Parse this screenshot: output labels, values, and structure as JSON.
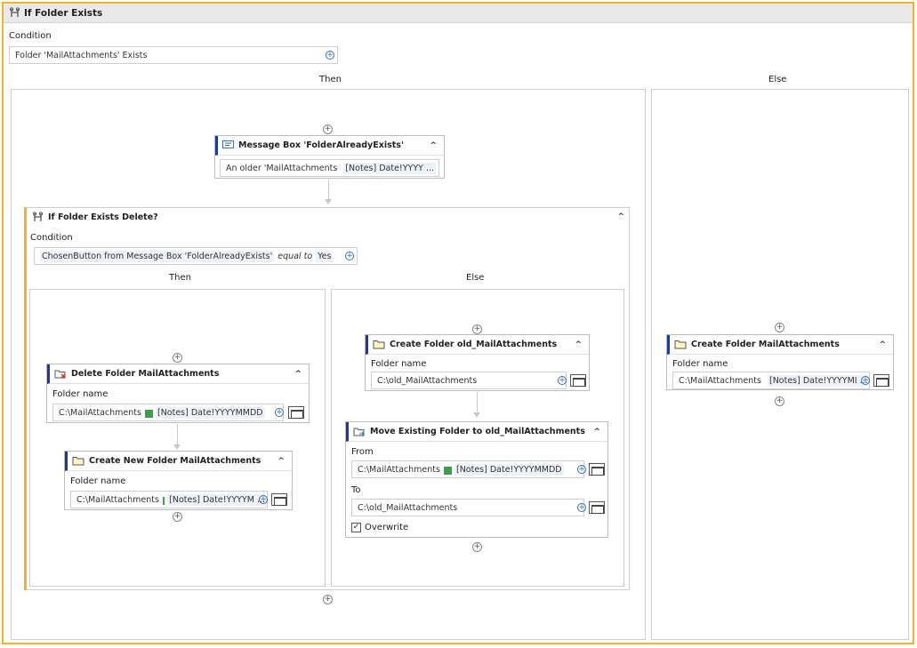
{
  "outer": {
    "title": "If Folder Exists",
    "condition_label": "Condition",
    "condition_value": "Folder 'MailAttachments' Exists",
    "then_label": "Then",
    "else_label": "Else"
  },
  "message_box": {
    "title": "Message Box 'FolderAlreadyExists'",
    "text_prefix": "An older 'MailAttachments",
    "text_var": "[Notes] Date!YYYY ..."
  },
  "inner_if": {
    "title": "If Folder Exists Delete?",
    "condition_label": "Condition",
    "cond_part1": "ChosenButton from Message Box 'FolderAlreadyExists'",
    "cond_op": "equal to",
    "cond_value": "Yes",
    "then_label": "Then",
    "else_label": "Else"
  },
  "delete_folder": {
    "title": "Delete Folder MailAttachments",
    "field_label": "Folder name",
    "value_prefix": "C:\\MailAttachments",
    "value_var": "[Notes] Date!YYYYMMDD"
  },
  "create_new_folder": {
    "title": "Create New Folder MailAttachments",
    "field_label": "Folder name",
    "value_prefix": "C:\\MailAttachments",
    "value_var": "[Notes] Date!YYYYM ..."
  },
  "create_old_folder": {
    "title": "Create Folder old_MailAttachments",
    "field_label": "Folder name",
    "value": "C:\\old_MailAttachments"
  },
  "move_folder": {
    "title": "Move Existing Folder to old_MailAttachments",
    "from_label": "From",
    "from_prefix": "C:\\MailAttachments",
    "from_var": "[Notes] Date!YYYYMMDD",
    "to_label": "To",
    "to_value": "C:\\old_MailAttachments",
    "overwrite_label": "Overwrite",
    "overwrite_checked": true
  },
  "else_create_folder": {
    "title": "Create Folder MailAttachments",
    "field_label": "Folder name",
    "value_prefix": "C:\\MailAttachments",
    "value_var": "[Notes] Date!YYYYMI ..."
  },
  "symbols": {
    "plus": "+",
    "chevron": "^",
    "check": "✓"
  }
}
